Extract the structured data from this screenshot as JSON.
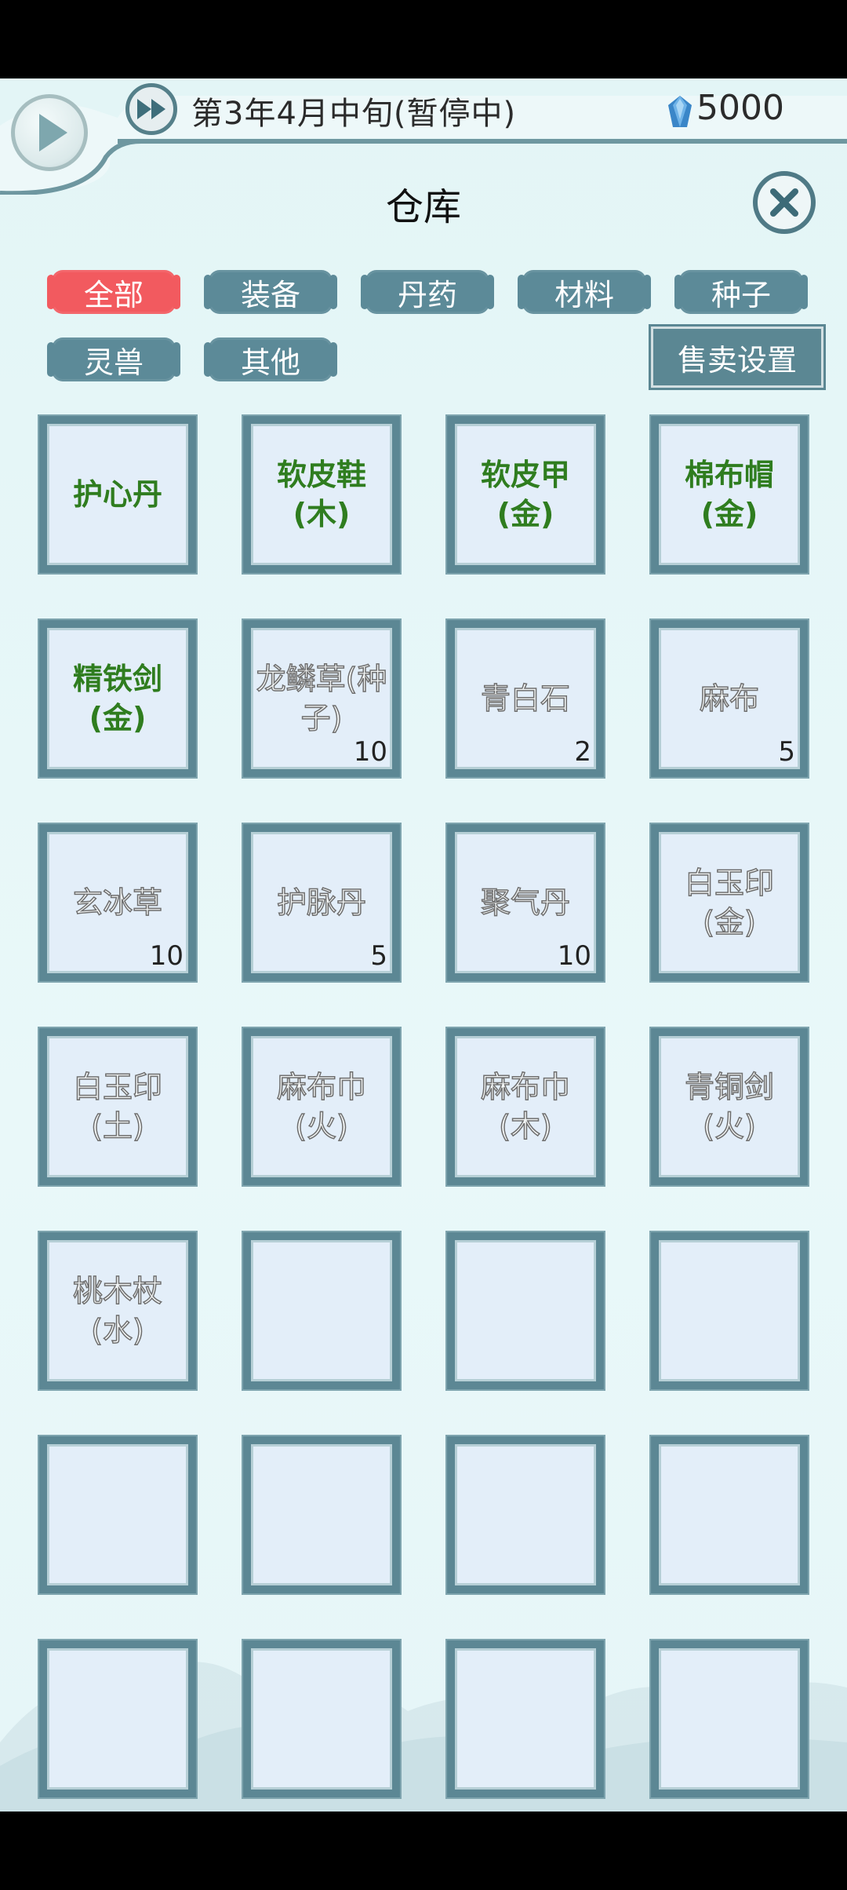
{
  "header": {
    "date": "第3年4月中旬(暂停中)",
    "currency": "5000"
  },
  "title": "仓库",
  "tabs": [
    {
      "label": "全部",
      "active": true
    },
    {
      "label": "装备",
      "active": false
    },
    {
      "label": "丹药",
      "active": false
    },
    {
      "label": "材料",
      "active": false
    },
    {
      "label": "种子",
      "active": false
    },
    {
      "label": "灵兽",
      "active": false
    },
    {
      "label": "其他",
      "active": false
    }
  ],
  "sell_settings_label": "售卖设置",
  "items": [
    {
      "name": "护心丹",
      "count": "",
      "style": "green"
    },
    {
      "name": "软皮鞋(木)",
      "count": "",
      "style": "green"
    },
    {
      "name": "软皮甲(金)",
      "count": "",
      "style": "green"
    },
    {
      "name": "棉布帽(金)",
      "count": "",
      "style": "green"
    },
    {
      "name": "精铁剑(金)",
      "count": "",
      "style": "green"
    },
    {
      "name": "龙鳞草(种子)",
      "count": "10",
      "style": "gray"
    },
    {
      "name": "青白石",
      "count": "2",
      "style": "gray"
    },
    {
      "name": "麻布",
      "count": "5",
      "style": "gray"
    },
    {
      "name": "玄冰草",
      "count": "10",
      "style": "gray"
    },
    {
      "name": "护脉丹",
      "count": "5",
      "style": "gray"
    },
    {
      "name": "聚气丹",
      "count": "10",
      "style": "gray"
    },
    {
      "name": "白玉印(金)",
      "count": "",
      "style": "gray"
    },
    {
      "name": "白玉印(土)",
      "count": "",
      "style": "gray"
    },
    {
      "name": "麻布巾(火)",
      "count": "",
      "style": "gray"
    },
    {
      "name": "麻布巾(木)",
      "count": "",
      "style": "gray"
    },
    {
      "name": "青铜剑(火)",
      "count": "",
      "style": "gray"
    },
    {
      "name": "桃木杖(水)",
      "count": "",
      "style": "gray"
    },
    {
      "name": "",
      "count": "",
      "style": "empty"
    },
    {
      "name": "",
      "count": "",
      "style": "empty"
    },
    {
      "name": "",
      "count": "",
      "style": "empty"
    },
    {
      "name": "",
      "count": "",
      "style": "empty"
    },
    {
      "name": "",
      "count": "",
      "style": "empty"
    },
    {
      "name": "",
      "count": "",
      "style": "empty"
    },
    {
      "name": "",
      "count": "",
      "style": "empty"
    },
    {
      "name": "",
      "count": "",
      "style": "empty"
    },
    {
      "name": "",
      "count": "",
      "style": "empty"
    },
    {
      "name": "",
      "count": "",
      "style": "empty"
    },
    {
      "name": "",
      "count": "",
      "style": "empty"
    }
  ],
  "colors": {
    "accent_red": "#f25a5f",
    "tab_teal": "#5c8a98",
    "item_green": "#2f7d1f",
    "slot_border": "#5c8794"
  },
  "icons": {
    "play": "play-icon",
    "fast_forward": "fast-forward-icon",
    "gem": "gem-icon",
    "close": "close-icon"
  }
}
